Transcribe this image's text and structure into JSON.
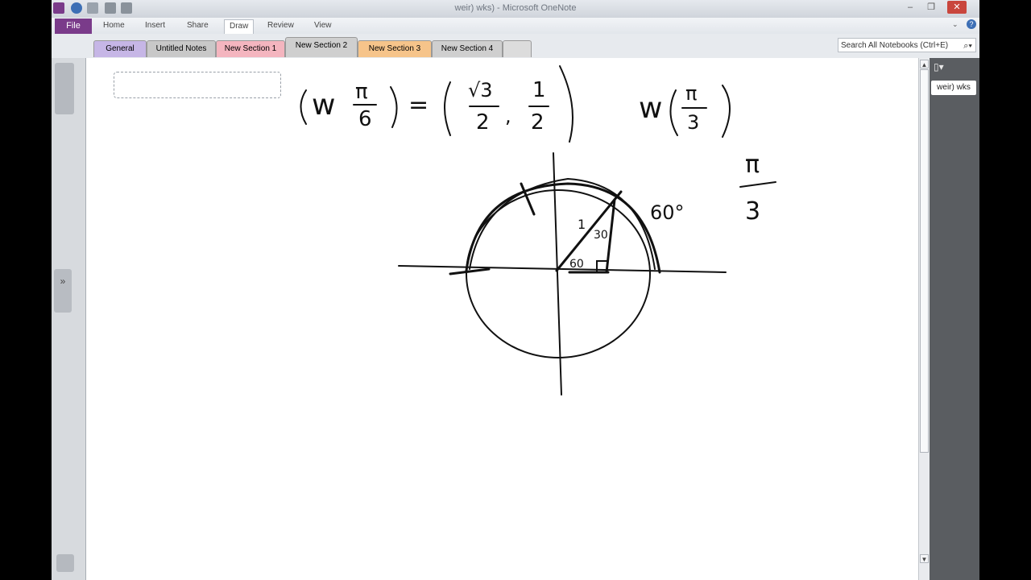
{
  "window": {
    "title": "weir) wks) - Microsoft OneNote",
    "controls": {
      "minimize": "–",
      "restore": "❐",
      "close": "✕"
    }
  },
  "ribbon": {
    "file_label": "File",
    "tabs": [
      "Home",
      "Insert",
      "Share",
      "Draw",
      "Review",
      "View"
    ],
    "active_tab": "Draw"
  },
  "sections": [
    {
      "label": "General",
      "color": "#c6b6e6"
    },
    {
      "label": "Untitled Notes",
      "color": "#c8c8c8"
    },
    {
      "label": "New Section 1",
      "color": "#f4b5bf"
    },
    {
      "label": "New Section 2",
      "color": "#cfcfcf"
    },
    {
      "label": "New Section 3",
      "color": "#f6c48a"
    },
    {
      "label": "New Section 4",
      "color": "#cfcfcf"
    }
  ],
  "search": {
    "placeholder": "Search All Notebooks (Ctrl+E)"
  },
  "pages": [
    "weir) wks"
  ],
  "canvas": {
    "ink_texts": {
      "eq1_lhs_fn": "w",
      "eq1_lhs_num": "π",
      "eq1_lhs_den": "6",
      "eq1_equals": "=",
      "eq1_r1_num": "√3",
      "eq1_r1_den": "2",
      "eq1_comma": ",",
      "eq1_r2_num": "1",
      "eq1_r2_den": "2",
      "eq2_fn": "w",
      "eq2_num": "π",
      "eq2_den": "3",
      "side_num": "π",
      "side_den": "3",
      "angle_60_label": "60°",
      "hyp_label": "1",
      "angle_30": "30",
      "angle_60_inner": "60"
    }
  }
}
